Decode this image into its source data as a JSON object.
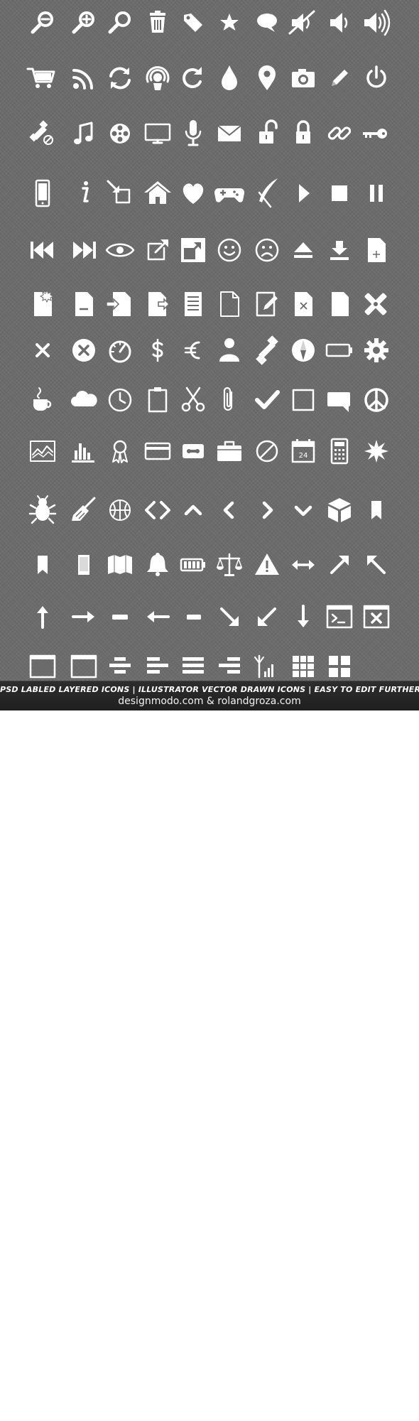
{
  "sheet": {
    "background": "#6b6b6b",
    "icon_color": "#ffffff"
  },
  "icons": [
    "zoom-out-icon",
    "zoom-in-icon",
    "search-icon",
    "trash-icon",
    "tag-icon",
    "star-icon",
    "speech-bubble-icon",
    "mute-icon",
    "volume-low-icon",
    "volume-high-icon",
    "shopping-cart-icon",
    "rss-icon",
    "refresh-icon",
    "podcast-icon",
    "reload-icon",
    "drop-icon",
    "map-pin-icon",
    "camera-icon",
    "pencil-icon",
    "power-icon",
    "satellite-off-icon",
    "music-note-icon",
    "film-reel-icon",
    "monitor-icon",
    "microphone-icon",
    "mail-icon",
    "unlock-icon",
    "lock-icon",
    "link-icon",
    "key-icon",
    "smartphone-icon",
    "info-icon",
    "resize-in-icon",
    "home-icon",
    "heart-icon",
    "gamepad-icon",
    "quill-icon",
    "play-icon",
    "stop-icon",
    "pause-icon",
    "skip-back-icon",
    "skip-forward-icon",
    "eye-icon",
    "external-link-icon",
    "fullscreen-icon",
    "smiley-icon",
    "sad-face-icon",
    "eject-icon",
    "download-icon",
    "add-document-icon",
    "document-new-icon",
    "document-minus-icon",
    "document-import-icon",
    "document-export-icon",
    "document-list-icon",
    "document-blank-icon",
    "document-edit-icon",
    "document-delete-icon",
    "document-icon",
    "tools-icon",
    "close-icon",
    "cancel-circle-icon",
    "speedometer-icon",
    "dollar-icon",
    "euro-icon",
    "user-icon",
    "satellite-icon",
    "compass-icon",
    "battery-icon",
    "gear-icon",
    "coffee-cup-icon",
    "cloud-icon",
    "clock-icon",
    "clipboard-icon",
    "scissors-icon",
    "paperclip-icon",
    "checkmark-icon",
    "checkbox-empty-icon",
    "comment-icon",
    "peace-icon",
    "image-chart-icon",
    "bar-chart-icon",
    "award-ribbon-icon",
    "credit-card-icon",
    "cassette-icon",
    "briefcase-icon",
    "block-icon",
    "calendar-icon",
    "calculator-icon",
    "burst-icon",
    "bug-icon",
    "broom-icon",
    "basketball-icon",
    "code-icon",
    "chevron-up-icon",
    "chevron-left-icon",
    "chevron-right-icon",
    "chevron-down-icon",
    "box-3d-icon",
    "bookmark-icon",
    "bookmark-outline-icon",
    "book-icon",
    "map-icon",
    "bell-icon",
    "battery-full-icon",
    "scales-icon",
    "warning-icon",
    "arrows-horizontal-icon",
    "arrow-up-right-icon",
    "arrow-up-left-icon",
    "arrow-up-icon",
    "arrow-right-icon",
    "minus-dash-icon",
    "arrow-left-icon",
    "minus-dash-small-icon",
    "arrow-down-right-icon",
    "arrow-down-left-icon",
    "arrow-down-icon",
    "terminal-icon",
    "window-close-icon",
    "window-toolbar-icon",
    "window-icon",
    "align-center-icon",
    "align-left-icon",
    "align-justify-icon",
    "align-right-icon",
    "antenna-signal-icon",
    "grid-9-icon",
    "grid-4-icon"
  ],
  "calendar_day": "24",
  "footer": {
    "line1": "PSD LABLED LAYERED ICONS | ILLUSTRATOR VECTOR DRAWN ICONS | EASY TO EDIT FURTHER",
    "line2": "designmodo.com & rolandgroza.com"
  }
}
